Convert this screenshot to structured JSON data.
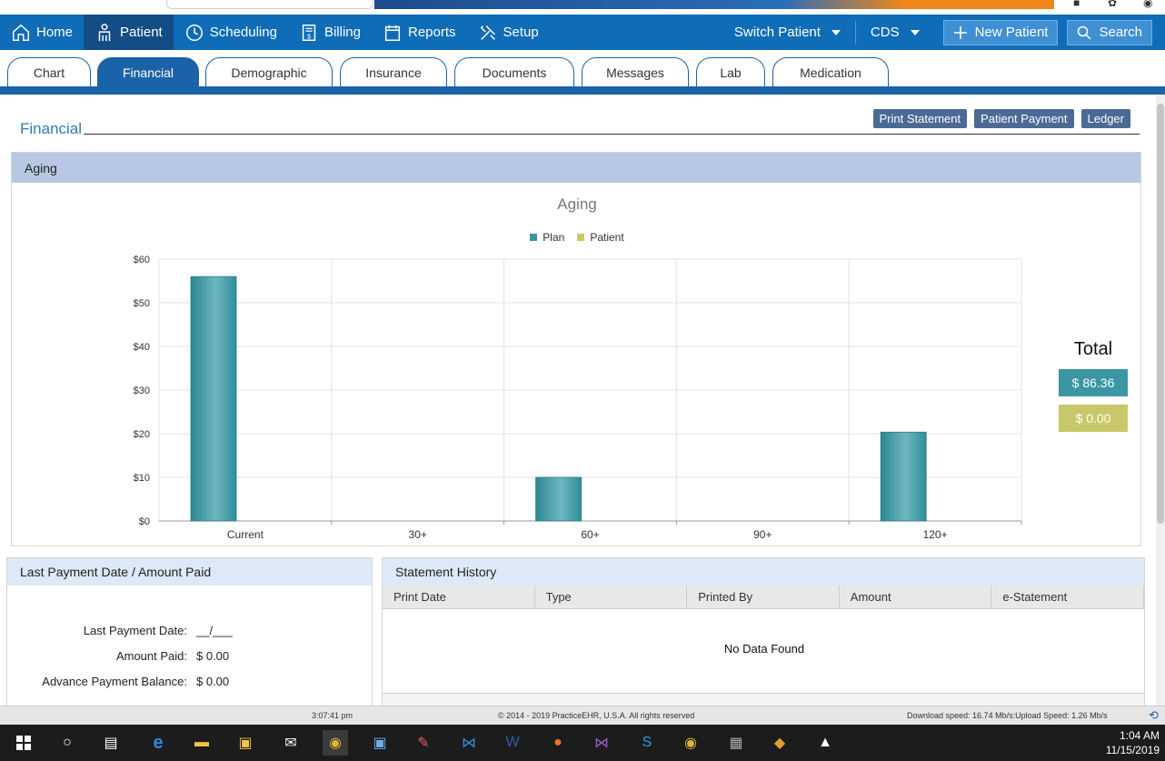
{
  "nav": {
    "items": [
      {
        "label": "Home",
        "icon": "home-icon"
      },
      {
        "label": "Patient",
        "icon": "patient-icon"
      },
      {
        "label": "Scheduling",
        "icon": "clock-icon"
      },
      {
        "label": "Billing",
        "icon": "billing-icon"
      },
      {
        "label": "Reports",
        "icon": "calendar-icon"
      },
      {
        "label": "Setup",
        "icon": "tools-icon"
      }
    ],
    "switch_patient": "Switch Patient",
    "cds": "CDS",
    "new_patient": "New Patient",
    "search": "Search"
  },
  "tabs": [
    "Chart",
    "Financial",
    "Demographic",
    "Insurance",
    "Documents",
    "Messages",
    "Lab",
    "Medication"
  ],
  "page": {
    "section_title": "Financial",
    "actions": [
      "Print Statement",
      "Patient Payment",
      "Ledger"
    ]
  },
  "aging": {
    "panel_title": "Aging",
    "totals_label": "Total",
    "plan_total": "$ 86.36",
    "patient_total": "$ 0.00"
  },
  "chart_data": {
    "type": "bar",
    "title": "Aging",
    "categories": [
      "Current",
      "30+",
      "60+",
      "90+",
      "120+"
    ],
    "series": [
      {
        "name": "Plan",
        "color": "#3a96a2",
        "values": [
          56,
          0,
          10,
          0,
          20.36
        ]
      },
      {
        "name": "Patient",
        "color": "#c8c86a",
        "values": [
          0,
          0,
          0,
          0,
          0
        ]
      }
    ],
    "ylim": [
      0,
      60
    ],
    "yticks": [
      "$0",
      "$10",
      "$20",
      "$30",
      "$40",
      "$50",
      "$60"
    ],
    "legend": "top-center",
    "grid": true
  },
  "last_payment": {
    "title": "Last Payment Date / Amount Paid",
    "rows": [
      {
        "label": "Last Payment Date:",
        "value": "__/___"
      },
      {
        "label": "Amount Paid:",
        "value": "$ 0.00"
      },
      {
        "label": "Advance Payment Balance:",
        "value": "$ 0.00"
      }
    ]
  },
  "statement_history": {
    "title": "Statement History",
    "columns": [
      "Print Date",
      "Type",
      "Printed By",
      "Amount",
      "e-Statement"
    ],
    "empty_text": "No Data Found"
  },
  "footer": {
    "time": "3:07:41 pm",
    "copyright": "© 2014 - 2019 PracticeEHR, U.S.A. All rights reserved",
    "speed": "Download speed: 16.74 Mb/s:Upload Speed: 1.26 Mb/s"
  },
  "taskbar": {
    "time": "1:04 AM",
    "date": "11/15/2019"
  },
  "colors": {
    "nav": "#0f6cb6",
    "tab_active": "#1b63a8",
    "plan": "#3a96a2",
    "patient": "#c8c86a",
    "action_button": "#4b6a96"
  }
}
